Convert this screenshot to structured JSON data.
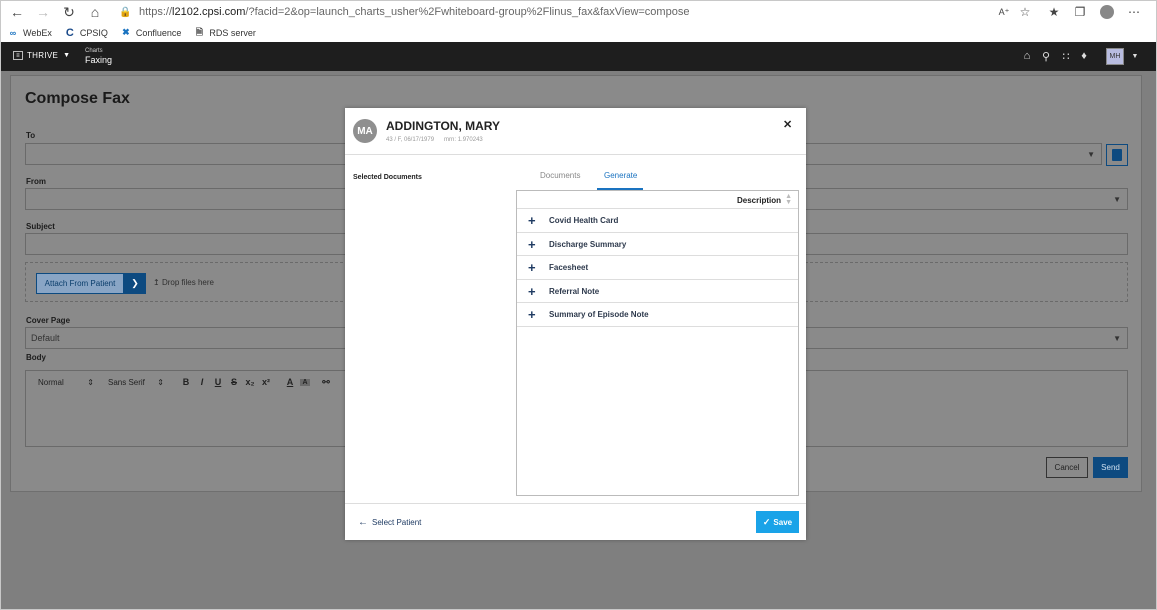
{
  "browser": {
    "url_prefix": "https://",
    "url_host": "l2102.cpsi.com",
    "url_path": "/?facid=2&op=launch_charts_usher%2Fwhiteboard-group%2Flinus_fax&faxView=compose",
    "bookmarks": [
      {
        "label": "WebEx",
        "icon": "webex-icon"
      },
      {
        "label": "CPSIQ",
        "icon": "cpsiq-icon"
      },
      {
        "label": "Confluence",
        "icon": "confluence-icon"
      },
      {
        "label": "RDS server",
        "icon": "page-icon"
      }
    ]
  },
  "appnav": {
    "brand": "THRIVE",
    "crumb_parent": "Charts",
    "crumb_current": "Faxing",
    "user_initials": "MH"
  },
  "compose": {
    "title": "Compose Fax",
    "to_label": "To",
    "from_label": "From",
    "subject_label": "Subject",
    "attach_label": "Attach From Patient",
    "drop_label": "Drop files here",
    "cover_label": "Cover Page",
    "cover_value": "Default",
    "body_label": "Body",
    "toolbar": {
      "format": "Normal",
      "font": "Sans Serif",
      "bold": "B",
      "italic": "I",
      "underline": "U",
      "strike": "S",
      "sub": "x₂",
      "sup": "x²",
      "color": "A",
      "bg": "A"
    },
    "cancel_label": "Cancel",
    "send_label": "Send"
  },
  "modal": {
    "avatar": "MA",
    "patient_name": "ADDINGTON, MARY",
    "demographics": "43 / F, 06/17/1979",
    "mrn": "mrn: 1.970243",
    "selected_docs_label": "Selected Documents",
    "tabs": {
      "documents": "Documents",
      "generate": "Generate"
    },
    "table_header": "Description",
    "documents": [
      "Covid Health Card",
      "Discharge Summary",
      "Facesheet",
      "Referral Note",
      "Summary of Episode Note"
    ],
    "back_label": "Select Patient",
    "save_label": "Save"
  }
}
